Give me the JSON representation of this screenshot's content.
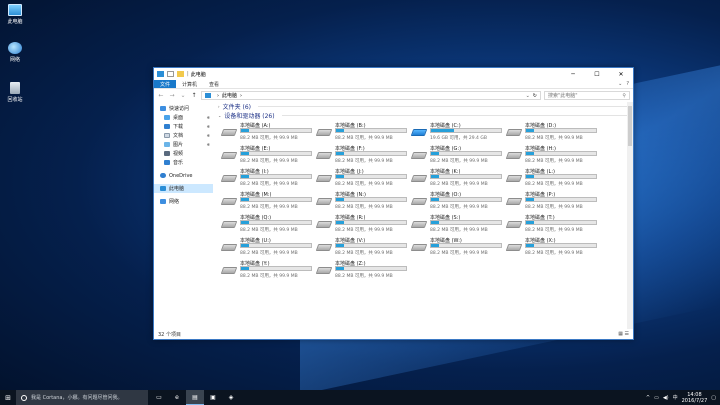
{
  "desktop": {
    "icons": [
      {
        "label": "此电脑",
        "icon": "this-pc-icon"
      },
      {
        "label": "网络",
        "icon": "network-icon"
      },
      {
        "label": "回收站",
        "icon": "recycle-bin-icon"
      }
    ]
  },
  "window": {
    "title": "此电脑",
    "controls": {
      "minimize": "─",
      "maximize": "☐",
      "close": "✕"
    },
    "ribbon": {
      "tabs": [
        "文件",
        "计算机",
        "查看"
      ],
      "expand": "⌄",
      "help": "?"
    },
    "nav": {
      "back": "←",
      "forward": "→",
      "recent": "⌄",
      "up": "↑"
    },
    "address": {
      "separator": "›",
      "location": "此电脑",
      "trail": "›",
      "dropdown": "⌄",
      "refresh": "↻"
    },
    "search": {
      "placeholder": "搜索\"此电脑\"",
      "icon": "⚲"
    },
    "navpane": {
      "quick_access": "快速访问",
      "items": [
        {
          "label": "桌面",
          "pin": "✱"
        },
        {
          "label": "下载",
          "pin": "✱"
        },
        {
          "label": "文档",
          "pin": "✱"
        },
        {
          "label": "图片",
          "pin": "✱"
        },
        {
          "label": "视频",
          "pin": ""
        },
        {
          "label": "音乐",
          "pin": ""
        }
      ],
      "onedrive": "OneDrive",
      "this_pc": "此电脑",
      "network": "网络"
    },
    "groups": {
      "folders": "文件夹 (6)",
      "drives": "设备和驱动器 (26)",
      "chevron_folders": "›",
      "chevron_drives": "⌄"
    },
    "drives": [
      {
        "name": "本地磁盘 (A:)",
        "space": "88.2 MB 可用，共 99.9 MB",
        "used": 0.12,
        "win": false
      },
      {
        "name": "本地磁盘 (B:)",
        "space": "88.2 MB 可用，共 99.9 MB",
        "used": 0.12,
        "win": false
      },
      {
        "name": "本地磁盘 (C:)",
        "space": "19.6 GB 可用，共 29.4 GB",
        "used": 0.33,
        "win": true
      },
      {
        "name": "本地磁盘 (D:)",
        "space": "88.2 MB 可用，共 99.9 MB",
        "used": 0.12,
        "win": false
      },
      {
        "name": "本地磁盘 (E:)",
        "space": "88.2 MB 可用，共 99.9 MB",
        "used": 0.12,
        "win": false
      },
      {
        "name": "本地磁盘 (F:)",
        "space": "88.2 MB 可用，共 99.9 MB",
        "used": 0.12,
        "win": false
      },
      {
        "name": "本地磁盘 (G:)",
        "space": "88.2 MB 可用，共 99.9 MB",
        "used": 0.12,
        "win": false
      },
      {
        "name": "本地磁盘 (H:)",
        "space": "88.2 MB 可用，共 99.9 MB",
        "used": 0.12,
        "win": false
      },
      {
        "name": "本地磁盘 (I:)",
        "space": "88.2 MB 可用，共 99.9 MB",
        "used": 0.12,
        "win": false
      },
      {
        "name": "本地磁盘 (J:)",
        "space": "88.2 MB 可用，共 99.9 MB",
        "used": 0.12,
        "win": false
      },
      {
        "name": "本地磁盘 (K:)",
        "space": "88.2 MB 可用，共 99.9 MB",
        "used": 0.12,
        "win": false
      },
      {
        "name": "本地磁盘 (L:)",
        "space": "88.2 MB 可用，共 99.9 MB",
        "used": 0.12,
        "win": false
      },
      {
        "name": "本地磁盘 (M:)",
        "space": "88.2 MB 可用，共 99.9 MB",
        "used": 0.12,
        "win": false
      },
      {
        "name": "本地磁盘 (N:)",
        "space": "88.2 MB 可用，共 99.9 MB",
        "used": 0.12,
        "win": false
      },
      {
        "name": "本地磁盘 (O:)",
        "space": "88.2 MB 可用，共 99.9 MB",
        "used": 0.12,
        "win": false
      },
      {
        "name": "本地磁盘 (P:)",
        "space": "88.2 MB 可用，共 99.9 MB",
        "used": 0.12,
        "win": false
      },
      {
        "name": "本地磁盘 (Q:)",
        "space": "88.2 MB 可用，共 99.9 MB",
        "used": 0.12,
        "win": false
      },
      {
        "name": "本地磁盘 (R:)",
        "space": "88.2 MB 可用，共 99.9 MB",
        "used": 0.12,
        "win": false
      },
      {
        "name": "本地磁盘 (S:)",
        "space": "88.2 MB 可用，共 99.9 MB",
        "used": 0.12,
        "win": false
      },
      {
        "name": "本地磁盘 (T:)",
        "space": "88.2 MB 可用，共 99.9 MB",
        "used": 0.12,
        "win": false
      },
      {
        "name": "本地磁盘 (U:)",
        "space": "88.2 MB 可用，共 99.9 MB",
        "used": 0.12,
        "win": false
      },
      {
        "name": "本地磁盘 (V:)",
        "space": "88.2 MB 可用，共 99.9 MB",
        "used": 0.12,
        "win": false
      },
      {
        "name": "本地磁盘 (W:)",
        "space": "88.2 MB 可用，共 99.9 MB",
        "used": 0.12,
        "win": false
      },
      {
        "name": "本地磁盘 (X:)",
        "space": "88.2 MB 可用，共 99.9 MB",
        "used": 0.12,
        "win": false
      },
      {
        "name": "本地磁盘 (Y:)",
        "space": "88.2 MB 可用，共 99.9 MB",
        "used": 0.12,
        "win": false
      },
      {
        "name": "本地磁盘 (Z:)",
        "space": "88.2 MB 可用，共 99.9 MB",
        "used": 0.12,
        "win": false
      }
    ],
    "status": {
      "count": "32 个项目",
      "views": "▦ ☰"
    }
  },
  "taskbar": {
    "start": "⊞",
    "search_text": "我是 Cortana，小娜。有问题尽管问我。",
    "apps": [
      {
        "glyph": "▭",
        "name": "task-view-icon",
        "active": false
      },
      {
        "glyph": "e",
        "name": "edge-icon",
        "active": false
      },
      {
        "glyph": "▤",
        "name": "file-explorer-icon",
        "active": true
      },
      {
        "glyph": "▣",
        "name": "store-icon",
        "active": false
      },
      {
        "glyph": "◈",
        "name": "app-icon",
        "active": false
      }
    ],
    "tray": {
      "expand": "^",
      "network": "▭",
      "volume": "◀)",
      "ime": "中",
      "time": "14:08",
      "date": "2016/7/27",
      "notifications": "▢"
    }
  },
  "colors": {
    "accent": "#1979ca",
    "drive_fill": "#26a0da"
  }
}
